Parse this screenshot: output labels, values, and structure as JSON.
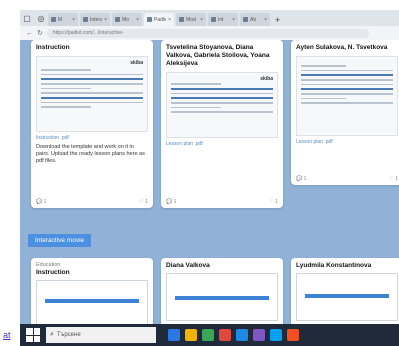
{
  "browser": {
    "tabs": [
      {
        "label": "M",
        "active": false
      },
      {
        "label": "Interactiv",
        "active": false
      },
      {
        "label": "Mo",
        "active": false
      },
      {
        "label": "Padlet",
        "active": true
      },
      {
        "label": "Mod",
        "active": false
      },
      {
        "label": "Int",
        "active": false
      },
      {
        "label": "Ab",
        "active": false
      }
    ],
    "url": "https://padlet.com/.../interactive-"
  },
  "board": {
    "cards": [
      {
        "title": "Instruction",
        "logo": "skiba",
        "link": "Instruction .pdf",
        "body": "Download the template and work on it in pairs. Upload the ready lesson plans here as pdf files.",
        "comments": "1",
        "likes": "1"
      },
      {
        "title": "Tsvetelina Stoyanova, Diana Valkova, Gabriela Stoilova, Yoana Aleksijeva",
        "logo": "skiba",
        "link": "Lesson plan .pdf",
        "comments": "1",
        "likes": "1"
      },
      {
        "title": "Ayten Sulakova, N. Tsvetkova",
        "link": "Lesson plan .pdf",
        "comments": "1",
        "likes": "1"
      }
    ],
    "section_label": "Interactive movie",
    "bottom_cards": [
      {
        "kicker": "Education",
        "title": "Instruction"
      },
      {
        "title": "Diana Valkova"
      },
      {
        "title": "Lyudmila Konstantinova"
      }
    ]
  },
  "taskbar": {
    "edge_text": "at",
    "search_placeholder": "Търсене",
    "icon_colors": [
      "#2b78e4",
      "#f0b400",
      "#3aa757",
      "#e0483b",
      "#1e88e5",
      "#7e57c2",
      "#00a1f1",
      "#f25022"
    ]
  }
}
